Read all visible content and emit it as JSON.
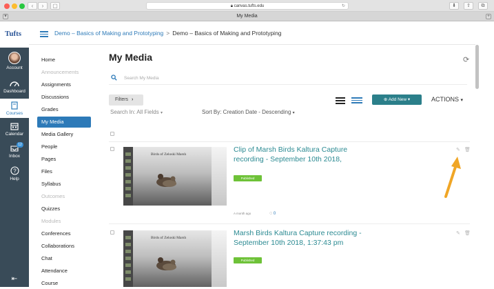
{
  "browser": {
    "url": "canvas.tufts.edu",
    "tab_title": "My Media"
  },
  "global_nav": {
    "logo": "Tufts",
    "items": [
      {
        "label": "Account",
        "icon": "avatar-icon"
      },
      {
        "label": "Dashboard",
        "icon": "dashboard-icon"
      },
      {
        "label": "Courses",
        "icon": "book-icon"
      },
      {
        "label": "Calendar",
        "icon": "calendar-icon"
      },
      {
        "label": "Inbox",
        "icon": "inbox-icon",
        "badge": "12"
      },
      {
        "label": "Help",
        "icon": "help-icon"
      }
    ],
    "collapse_icon": "collapse-icon"
  },
  "breadcrumb": {
    "course": "Demo – Basics of Making and Prototyping",
    "separator": ">",
    "current": "Demo – Basics of Making and Prototyping"
  },
  "course_nav": [
    {
      "label": "Home"
    },
    {
      "label": "Announcements"
    },
    {
      "label": "Assignments"
    },
    {
      "label": "Discussions"
    },
    {
      "label": "Grades"
    },
    {
      "label": "My Media"
    },
    {
      "label": "Media Gallery"
    },
    {
      "label": "People"
    },
    {
      "label": "Pages"
    },
    {
      "label": "Files"
    },
    {
      "label": "Syllabus"
    },
    {
      "label": "Outcomes"
    },
    {
      "label": "Quizzes"
    },
    {
      "label": "Modules"
    },
    {
      "label": "Conferences"
    },
    {
      "label": "Collaborations"
    },
    {
      "label": "Chat"
    },
    {
      "label": "Attendance"
    },
    {
      "label": "Course"
    }
  ],
  "main": {
    "title": "My Media",
    "search_placeholder": "Search My Media",
    "filters_label": "Filters",
    "add_new_label": "Add New",
    "actions_label": "ACTIONS",
    "search_in": "Search In: All Fields",
    "sort_by": "Sort By: Creation Date - Descending",
    "items": [
      {
        "title": "Clip of Marsh Birds Kaltura Capture recording - September 10th 2018,",
        "status": "Published",
        "age": "A month ago",
        "comments": "0",
        "thumb_title": "Birds of Zeloski Marsh"
      },
      {
        "title": "Marsh Birds Kaltura Capture recording - September 10th 2018, 1:37:43 pm",
        "status": "Published",
        "thumb_title": "Birds of Zeloski Marsh"
      }
    ]
  },
  "colors": {
    "nav_bg": "#394b58",
    "link": "#2d7ab8",
    "item_title": "#2b8a92",
    "published": "#6ec238",
    "add_new": "#2b7f8a",
    "arrow": "#f0a626"
  }
}
